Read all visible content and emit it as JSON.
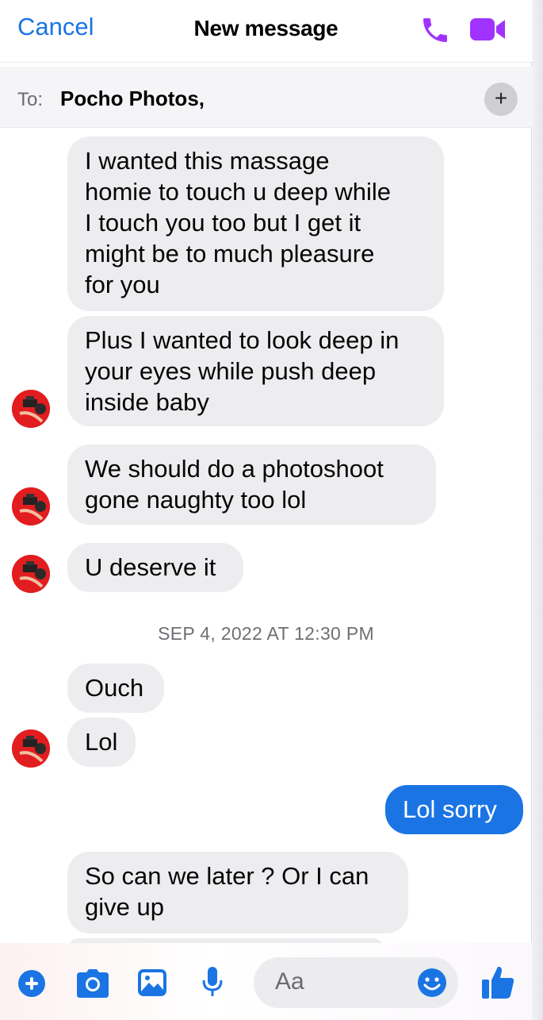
{
  "header": {
    "cancel_label": "Cancel",
    "title": "New message",
    "call_icon": "phone-icon",
    "video_icon": "video-camera-icon"
  },
  "to_bar": {
    "label": "To:",
    "recipient": "Pocho Photos,",
    "add_icon": "plus-icon"
  },
  "messages": [
    {
      "sender": "them",
      "text": "I wanted this massage\nhomie to touch u deep while\nI touch you too but I get it\nmight be to much pleasure\nfor you"
    },
    {
      "sender": "them",
      "text": "Plus I wanted to look deep in\nyour eyes while push deep\ninside baby"
    },
    {
      "sender": "them",
      "text": "We should do a photoshoot\ngone naughty too lol"
    },
    {
      "sender": "them",
      "text": "U deserve it"
    },
    {
      "sender": "them",
      "text": "Ouch"
    },
    {
      "sender": "them",
      "text": "Lol"
    },
    {
      "sender": "me",
      "text": "Lol sorry"
    },
    {
      "sender": "them",
      "text": "So can we later ? Or I can\ngive up"
    }
  ],
  "timestamp": "SEP 4, 2022 AT 12:30 PM",
  "composer": {
    "placeholder": "Aa",
    "icons": [
      "plus-circle-icon",
      "camera-icon",
      "photo-icon",
      "microphone-icon",
      "emoji-icon",
      "thumbs-up-icon"
    ]
  },
  "colors": {
    "accent_blue": "#1b74e4",
    "call_purple": "#a033ff",
    "bubble_gray": "#ededf0"
  }
}
